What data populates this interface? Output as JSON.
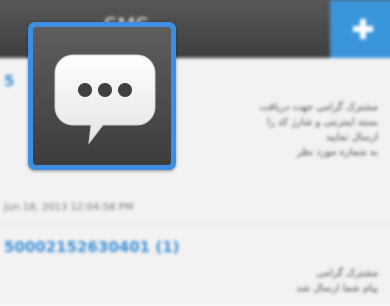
{
  "actionbar": {
    "title": "SMS",
    "add_icon": "plus-icon"
  },
  "threads": [
    {
      "number": "5",
      "preview_lines": [
        "مشترک گرامی جهت دریافت",
        "بسته اینترنتی و شارژ کد را",
        "ارسال نمایید",
        "به شماره مورد نظر"
      ],
      "date": "Jun 18, 2013 12:04:58 PM"
    },
    {
      "number": "500021526304​01 (1)",
      "preview_lines": [
        "مشترک گرامی",
        "پیام شما ارسال شد"
      ]
    }
  ],
  "overlay": {
    "icon": "chat-bubble-ellipsis-icon",
    "accent_color": "#3d8ee0"
  }
}
